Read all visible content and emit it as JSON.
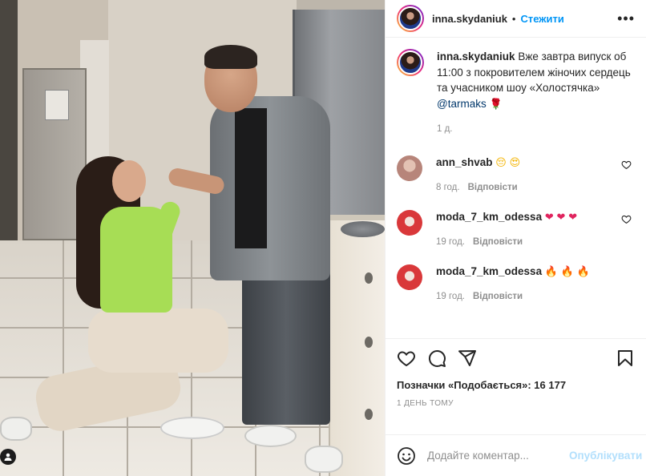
{
  "header": {
    "username": "inna.skydaniuk",
    "separator": "•",
    "follow_label": "Стежити",
    "more_label": "•••"
  },
  "caption": {
    "username": "inna.skydaniuk",
    "text": "Вже завтра випуск об 11:00 з покровителем жіночих сердець та учасником шоу «Холостячка» ",
    "mention": "@tarmaks",
    "emoji": "🌹",
    "time": "1 д."
  },
  "comments": [
    {
      "username": "ann_shvab",
      "text": "",
      "emojis": [
        "😔",
        "😍"
      ],
      "time": "8 год.",
      "reply": "Відповісти",
      "avatar_color": "#d9b7a6"
    },
    {
      "username": "moda_7_km_odessa",
      "text": "",
      "emojis": [
        "❤",
        "❤",
        "❤"
      ],
      "time": "19 год.",
      "reply": "Відповісти",
      "avatar_color": "#e03b3b"
    },
    {
      "username": "moda_7_km_odessa",
      "text": "",
      "emojis": [
        "🔥",
        "🔥",
        "🔥"
      ],
      "time": "19 год.",
      "reply": "Відповісти",
      "avatar_color": "#e03b3b"
    }
  ],
  "actions": {
    "likes_text": "Позначки «Подобається»: 16 177",
    "date": "1 ДЕНЬ ТОМУ"
  },
  "add_comment": {
    "placeholder": "Додайте коментар...",
    "publish_label": "Опублікувати"
  },
  "colors": {
    "accent": "#0095f6",
    "publish_disabled": "#b2dffc",
    "meta": "#8e8e8e"
  }
}
